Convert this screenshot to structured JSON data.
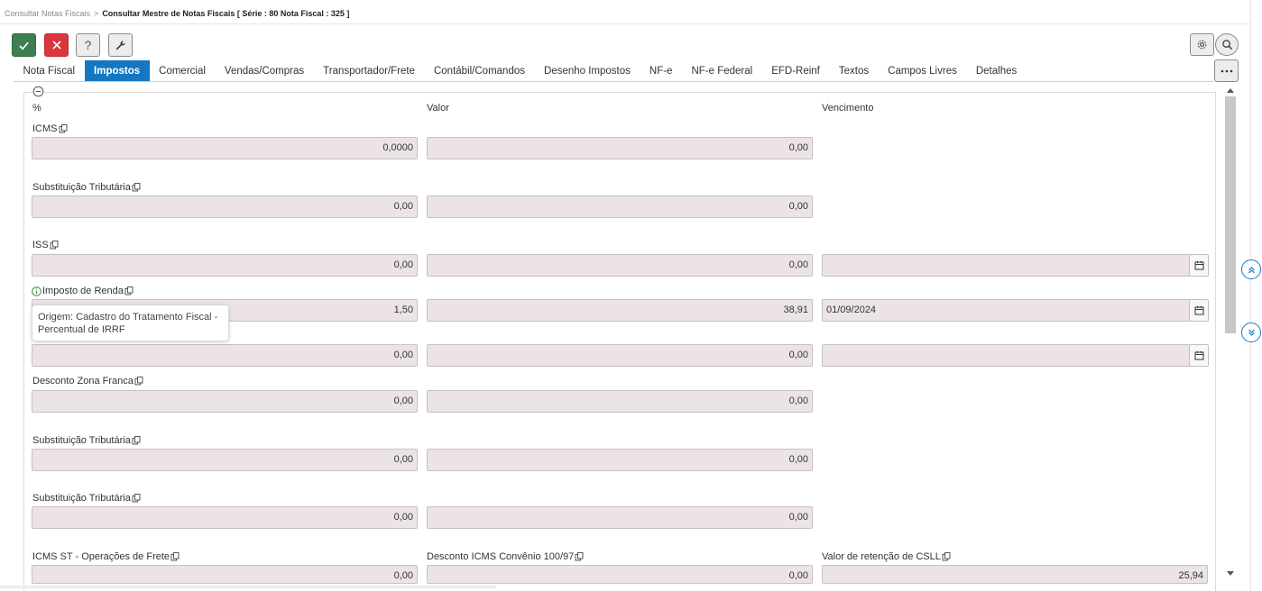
{
  "breadcrumb": {
    "parent": "Consultar Notas Fiscais",
    "separator": ">",
    "current": "Consultar Mestre de Notas Fiscais [ Série : 80 Nota Fiscal : 325 ]"
  },
  "toolbar": {
    "help_label": "?"
  },
  "tabs": [
    {
      "label": "Nota Fiscal",
      "active": false
    },
    {
      "label": "Impostos",
      "active": true
    },
    {
      "label": "Comercial",
      "active": false
    },
    {
      "label": "Vendas/Compras",
      "active": false
    },
    {
      "label": "Transportador/Frete",
      "active": false
    },
    {
      "label": "Contábil/Comandos",
      "active": false
    },
    {
      "label": "Desenho Impostos",
      "active": false
    },
    {
      "label": "NF-e",
      "active": false
    },
    {
      "label": "NF-e Federal",
      "active": false
    },
    {
      "label": "EFD-Reinf",
      "active": false
    },
    {
      "label": "Textos",
      "active": false
    },
    {
      "label": "Campos Livres",
      "active": false
    },
    {
      "label": "Detalhes",
      "active": false
    }
  ],
  "headers": {
    "percent": "%",
    "value": "Valor",
    "due": "Vencimento"
  },
  "rows": [
    {
      "label": "ICMS",
      "percent": "0,0000",
      "value": "0,00"
    },
    {
      "label": "Substituição Tributária",
      "percent": "0,00",
      "value": "0,00"
    },
    {
      "label": "ISS",
      "percent": "0,00",
      "value": "0,00",
      "due": ""
    },
    {
      "label": "Imposto de Renda",
      "percent": "1,50",
      "value": "38,91",
      "due": "01/09/2024"
    },
    {
      "label": "",
      "percent": "0,00",
      "value": "0,00",
      "due": ""
    },
    {
      "label": "Desconto Zona Franca",
      "percent": "0,00",
      "value": "0,00"
    },
    {
      "label": "Substituição Tributária",
      "percent": "0,00",
      "value": "0,00"
    },
    {
      "label": "Substituição Tributária",
      "percent": "0,00",
      "value": "0,00"
    }
  ],
  "last_row": {
    "icms_st_label": "ICMS ST - Operações de Frete",
    "icms_st_value": "0,00",
    "desconto_label": "Desconto ICMS Convênio 100/97",
    "desconto_value": "0,00",
    "csll_label": "Valor de retenção de CSLL",
    "csll_value": "25,94"
  },
  "tooltip": {
    "line1": "Origem: Cadastro do Tratamento Fiscal -",
    "line2": "Percentual de IRRF"
  },
  "colors": {
    "accent": "#1477c2",
    "confirm": "#3d7f52",
    "cancel": "#d9363e",
    "field_bg": "#ece4e4",
    "info_green": "#3a8a3a"
  }
}
